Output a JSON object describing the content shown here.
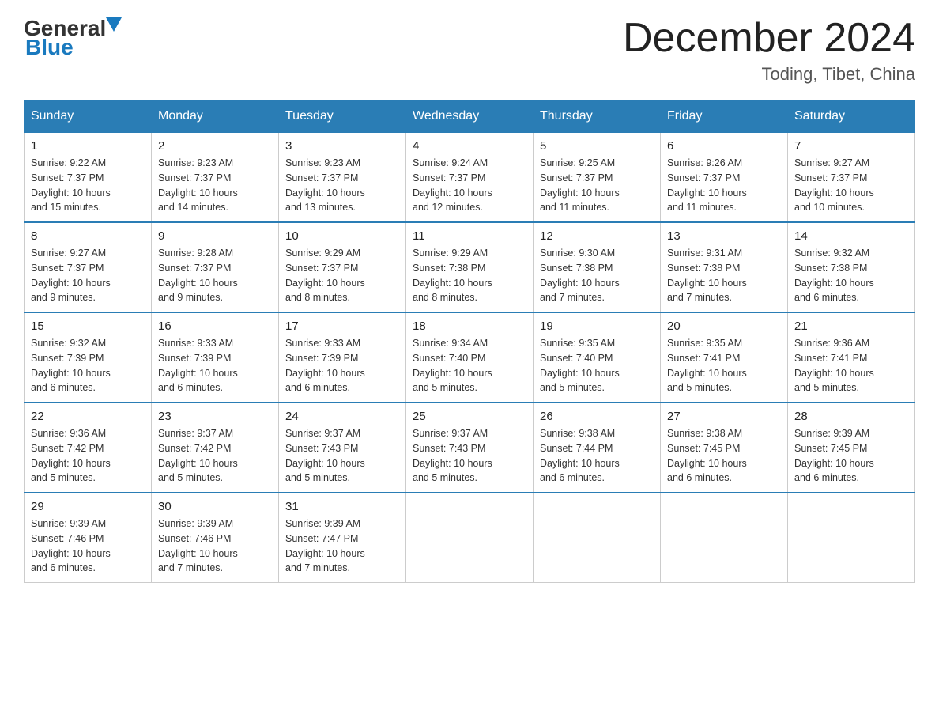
{
  "header": {
    "logo_general": "General",
    "logo_blue": "Blue",
    "month_title": "December 2024",
    "location": "Toding, Tibet, China"
  },
  "days_of_week": [
    "Sunday",
    "Monday",
    "Tuesday",
    "Wednesday",
    "Thursday",
    "Friday",
    "Saturday"
  ],
  "weeks": [
    [
      {
        "day": "1",
        "sunrise": "9:22 AM",
        "sunset": "7:37 PM",
        "daylight": "10 hours and 15 minutes."
      },
      {
        "day": "2",
        "sunrise": "9:23 AM",
        "sunset": "7:37 PM",
        "daylight": "10 hours and 14 minutes."
      },
      {
        "day": "3",
        "sunrise": "9:23 AM",
        "sunset": "7:37 PM",
        "daylight": "10 hours and 13 minutes."
      },
      {
        "day": "4",
        "sunrise": "9:24 AM",
        "sunset": "7:37 PM",
        "daylight": "10 hours and 12 minutes."
      },
      {
        "day": "5",
        "sunrise": "9:25 AM",
        "sunset": "7:37 PM",
        "daylight": "10 hours and 11 minutes."
      },
      {
        "day": "6",
        "sunrise": "9:26 AM",
        "sunset": "7:37 PM",
        "daylight": "10 hours and 11 minutes."
      },
      {
        "day": "7",
        "sunrise": "9:27 AM",
        "sunset": "7:37 PM",
        "daylight": "10 hours and 10 minutes."
      }
    ],
    [
      {
        "day": "8",
        "sunrise": "9:27 AM",
        "sunset": "7:37 PM",
        "daylight": "10 hours and 9 minutes."
      },
      {
        "day": "9",
        "sunrise": "9:28 AM",
        "sunset": "7:37 PM",
        "daylight": "10 hours and 9 minutes."
      },
      {
        "day": "10",
        "sunrise": "9:29 AM",
        "sunset": "7:37 PM",
        "daylight": "10 hours and 8 minutes."
      },
      {
        "day": "11",
        "sunrise": "9:29 AM",
        "sunset": "7:38 PM",
        "daylight": "10 hours and 8 minutes."
      },
      {
        "day": "12",
        "sunrise": "9:30 AM",
        "sunset": "7:38 PM",
        "daylight": "10 hours and 7 minutes."
      },
      {
        "day": "13",
        "sunrise": "9:31 AM",
        "sunset": "7:38 PM",
        "daylight": "10 hours and 7 minutes."
      },
      {
        "day": "14",
        "sunrise": "9:32 AM",
        "sunset": "7:38 PM",
        "daylight": "10 hours and 6 minutes."
      }
    ],
    [
      {
        "day": "15",
        "sunrise": "9:32 AM",
        "sunset": "7:39 PM",
        "daylight": "10 hours and 6 minutes."
      },
      {
        "day": "16",
        "sunrise": "9:33 AM",
        "sunset": "7:39 PM",
        "daylight": "10 hours and 6 minutes."
      },
      {
        "day": "17",
        "sunrise": "9:33 AM",
        "sunset": "7:39 PM",
        "daylight": "10 hours and 6 minutes."
      },
      {
        "day": "18",
        "sunrise": "9:34 AM",
        "sunset": "7:40 PM",
        "daylight": "10 hours and 5 minutes."
      },
      {
        "day": "19",
        "sunrise": "9:35 AM",
        "sunset": "7:40 PM",
        "daylight": "10 hours and 5 minutes."
      },
      {
        "day": "20",
        "sunrise": "9:35 AM",
        "sunset": "7:41 PM",
        "daylight": "10 hours and 5 minutes."
      },
      {
        "day": "21",
        "sunrise": "9:36 AM",
        "sunset": "7:41 PM",
        "daylight": "10 hours and 5 minutes."
      }
    ],
    [
      {
        "day": "22",
        "sunrise": "9:36 AM",
        "sunset": "7:42 PM",
        "daylight": "10 hours and 5 minutes."
      },
      {
        "day": "23",
        "sunrise": "9:37 AM",
        "sunset": "7:42 PM",
        "daylight": "10 hours and 5 minutes."
      },
      {
        "day": "24",
        "sunrise": "9:37 AM",
        "sunset": "7:43 PM",
        "daylight": "10 hours and 5 minutes."
      },
      {
        "day": "25",
        "sunrise": "9:37 AM",
        "sunset": "7:43 PM",
        "daylight": "10 hours and 5 minutes."
      },
      {
        "day": "26",
        "sunrise": "9:38 AM",
        "sunset": "7:44 PM",
        "daylight": "10 hours and 6 minutes."
      },
      {
        "day": "27",
        "sunrise": "9:38 AM",
        "sunset": "7:45 PM",
        "daylight": "10 hours and 6 minutes."
      },
      {
        "day": "28",
        "sunrise": "9:39 AM",
        "sunset": "7:45 PM",
        "daylight": "10 hours and 6 minutes."
      }
    ],
    [
      {
        "day": "29",
        "sunrise": "9:39 AM",
        "sunset": "7:46 PM",
        "daylight": "10 hours and 6 minutes."
      },
      {
        "day": "30",
        "sunrise": "9:39 AM",
        "sunset": "7:46 PM",
        "daylight": "10 hours and 7 minutes."
      },
      {
        "day": "31",
        "sunrise": "9:39 AM",
        "sunset": "7:47 PM",
        "daylight": "10 hours and 7 minutes."
      },
      null,
      null,
      null,
      null
    ]
  ],
  "labels": {
    "sunrise": "Sunrise:",
    "sunset": "Sunset:",
    "daylight": "Daylight:"
  }
}
